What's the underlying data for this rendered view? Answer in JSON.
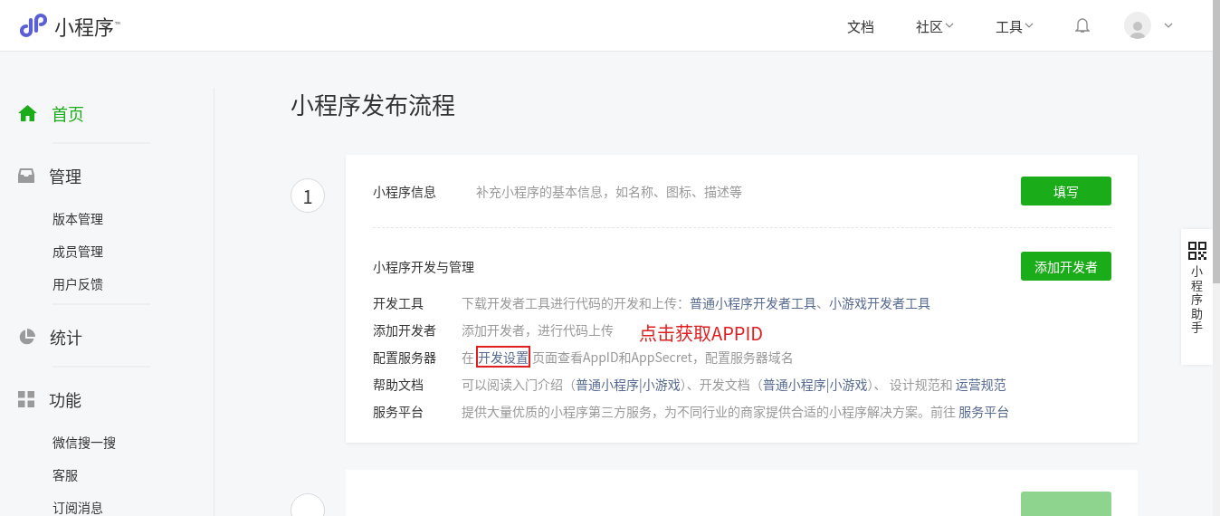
{
  "header": {
    "logo_text": "小程序",
    "logo_mark": "™",
    "nav": [
      {
        "label": "文档",
        "dropdown": false
      },
      {
        "label": "社区",
        "dropdown": true
      },
      {
        "label": "工具",
        "dropdown": true
      }
    ]
  },
  "sidebar": {
    "groups": [
      {
        "kind": "home",
        "label": "首页",
        "selected": true
      },
      {
        "kind": "tray",
        "label": "管理",
        "selected": false,
        "children": [
          {
            "label": "版本管理",
            "selected": false
          },
          {
            "label": "成员管理",
            "selected": false
          },
          {
            "label": "用户反馈",
            "selected": false
          }
        ]
      },
      {
        "kind": "pie",
        "label": "统计",
        "selected": false
      },
      {
        "kind": "grid",
        "label": "功能",
        "selected": false,
        "children": [
          {
            "label": "微信搜一搜",
            "selected": false
          },
          {
            "label": "客服",
            "selected": false
          },
          {
            "label": "订阅消息",
            "selected": false
          }
        ]
      }
    ]
  },
  "page_title": "小程序发布流程",
  "steps": [
    {
      "number": "1",
      "info": {
        "title": "小程序信息",
        "description": "补充小程序的基本信息，如名称、图标、描述等",
        "button": "填写"
      },
      "dev": {
        "title": "小程序开发与管理",
        "button": "添加开发者",
        "rows": [
          {
            "label": "开发工具",
            "segments": [
              {
                "kind": "text",
                "text": "下载开发者工具进行代码的开发和上传："
              },
              {
                "kind": "link",
                "text": "普通小程序开发者工具",
                "highlighted": false
              },
              {
                "kind": "text",
                "text": "、"
              },
              {
                "kind": "link",
                "text": "小游戏开发者工具",
                "highlighted": false
              }
            ]
          },
          {
            "label": "添加开发者",
            "segments": [
              {
                "kind": "text",
                "text": "添加开发者，进行代码上传"
              }
            ]
          },
          {
            "label": "配置服务器",
            "segments": [
              {
                "kind": "text",
                "text": "在"
              },
              {
                "kind": "link",
                "text": "开发设置",
                "highlighted": true
              },
              {
                "kind": "text",
                "text": "页面查看AppID和AppSecret，配置服务器域名"
              }
            ]
          },
          {
            "label": "帮助文档",
            "segments": [
              {
                "kind": "text",
                "text": "可以阅读入门介绍（"
              },
              {
                "kind": "link",
                "text": "普通小程序",
                "highlighted": false
              },
              {
                "kind": "link",
                "text": "|",
                "highlighted": false
              },
              {
                "kind": "link",
                "text": "小游戏",
                "highlighted": false
              },
              {
                "kind": "text",
                "text": "）、开发文档（"
              },
              {
                "kind": "link",
                "text": "普通小程序",
                "highlighted": false
              },
              {
                "kind": "link",
                "text": "|",
                "highlighted": false
              },
              {
                "kind": "link",
                "text": "小游戏",
                "highlighted": false
              },
              {
                "kind": "text",
                "text": "）、 设计规范和 "
              },
              {
                "kind": "link",
                "text": "运营规范",
                "highlighted": false
              }
            ]
          },
          {
            "label": "服务平台",
            "segments": [
              {
                "kind": "text",
                "text": "提供大量优质的小程序第三方服务，为不同行业的商家提供合适的小程序解决方案。前往 "
              },
              {
                "kind": "link",
                "text": "服务平台",
                "highlighted": false
              }
            ]
          }
        ]
      }
    }
  ],
  "annotation": {
    "text": "点击获取APPID"
  },
  "helper": {
    "label": "小程序助手"
  }
}
